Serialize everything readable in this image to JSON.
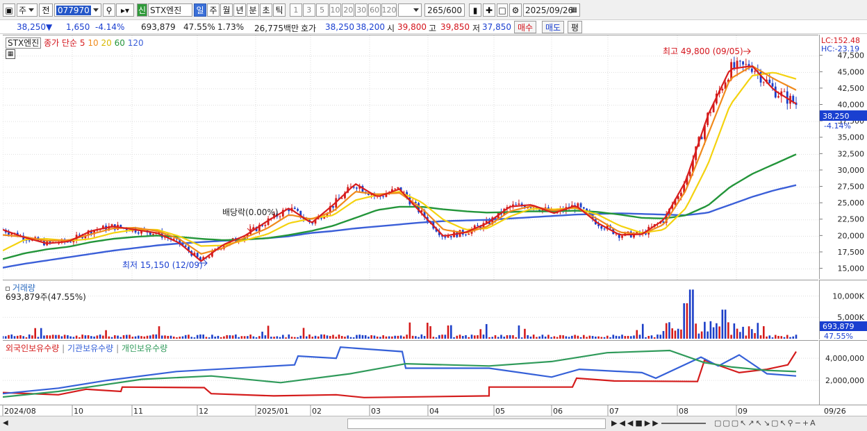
{
  "toolbar": {
    "period_options": [
      "주"
    ],
    "mode": "전",
    "code": "077970",
    "badge": "신",
    "name": "STX엔진",
    "intervals": [
      "일",
      "주",
      "월",
      "년",
      "분",
      "초",
      "틱"
    ],
    "selected_interval": "일",
    "tick_nums": [
      "1",
      "3",
      "5",
      "10",
      "20",
      "30",
      "60",
      "120"
    ],
    "count": "265",
    "count_total": "/600",
    "date": "2025/09/26"
  },
  "info": {
    "price": "38,250",
    "change": "1,650",
    "change_pct": "-4.14%",
    "volume": "693,879",
    "vol_ratio": "47.55%",
    "turnover": "1.73%",
    "amount": "26,775백만",
    "quote_label": "호가",
    "ask": "38,250",
    "bid": "38,200",
    "open_label": "시",
    "open": "39,800",
    "high_label": "고",
    "high": "39,850",
    "low_label": "저",
    "low": "37,850",
    "buy_label": "매수",
    "sell_label": "매도",
    "eval_label": "평"
  },
  "price_panel": {
    "legend_name": "STX엔진",
    "legend_ma": "종가 단순",
    "ma_periods": [
      "5",
      "10",
      "20",
      "60",
      "120"
    ],
    "ma_colors": [
      "#d81e1e",
      "#f08a1c",
      "#f4d20e",
      "#23953a",
      "#3b5fd8"
    ],
    "lc": "LC:152.48",
    "hc": "HC:-23.19",
    "y_ticks": [
      "47,500",
      "45,000",
      "42,500",
      "40,000",
      "37,500",
      "35,000",
      "32,500",
      "30,000",
      "27,500",
      "25,000",
      "22,500",
      "20,000",
      "17,500",
      "15,000"
    ],
    "current_price": "38,250",
    "current_pct": "-4.14%",
    "high_note": "최고 49,800 (09/05)",
    "low_note": "최저 15,150 (12/09)",
    "div_note": "배당락(0.00%)"
  },
  "volume_panel": {
    "title": "거래량",
    "value": "693,879주(47.55%)",
    "y_ticks": [
      "10,000K",
      "5,000K"
    ],
    "current": "693,879",
    "current_pct": "47.55%"
  },
  "holdings_panel": {
    "series": [
      "외국인보유수량",
      "기관보유수량",
      "개인보유수량"
    ],
    "colors": [
      "#d41b1b",
      "#3560d8",
      "#2f9a5a"
    ],
    "y_ticks": [
      "4,000,000",
      "2,000,000"
    ]
  },
  "x_axis": {
    "labels": [
      "2024/08",
      "10",
      "11",
      "12",
      "2025/01",
      "02",
      "03",
      "04",
      "05",
      "06",
      "07",
      "08",
      "09"
    ],
    "right_label": "09/26"
  },
  "chart_data": {
    "type": "line",
    "x_months": [
      "2024/08",
      "10",
      "11",
      "12",
      "2025/01",
      "02",
      "03",
      "04",
      "05",
      "06",
      "07",
      "08",
      "09"
    ],
    "ylim": [
      14000,
      49800
    ],
    "series": [
      {
        "name": "5",
        "values": [
          21000,
          19800,
          18900,
          19200,
          20800,
          21500,
          21000,
          20500,
          19000,
          16200,
          18700,
          20100,
          22300,
          24300,
          22000,
          24800,
          28000,
          26000,
          27200,
          23500,
          20000,
          20600,
          22000,
          24500,
          24800,
          23500,
          24700,
          22000,
          20200,
          20300,
          22500,
          28500,
          38500,
          45500,
          46000,
          42300,
          40200
        ]
      },
      {
        "name": "10",
        "values": [
          20200,
          19900,
          19300,
          19400,
          20300,
          21200,
          21300,
          20800,
          19600,
          17300,
          18200,
          19800,
          21200,
          23300,
          22600,
          23800,
          26800,
          26400,
          26600,
          24300,
          21000,
          20500,
          21500,
          23800,
          24600,
          23900,
          24400,
          22600,
          20600,
          20300,
          21800,
          27000,
          35500,
          44000,
          46000,
          44000,
          42300
        ]
      },
      {
        "name": "20",
        "values": [
          17800,
          19500,
          19600,
          19300,
          19600,
          20500,
          21000,
          21000,
          20000,
          18500,
          18600,
          19400,
          20300,
          22000,
          22700,
          23200,
          25500,
          26300,
          26800,
          25200,
          22500,
          21000,
          21200,
          23000,
          24200,
          24100,
          24300,
          23300,
          21600,
          20500,
          21000,
          24300,
          31000,
          40000,
          44500,
          45000,
          44000
        ]
      },
      {
        "name": "60",
        "values": [
          16500,
          17400,
          18000,
          18400,
          19100,
          19600,
          19900,
          20100,
          19900,
          19600,
          19400,
          19500,
          19700,
          20200,
          20800,
          21600,
          22800,
          24000,
          24500,
          24500,
          24100,
          23800,
          23600,
          23700,
          23800,
          23800,
          23900,
          23700,
          23300,
          22800,
          22700,
          23200,
          24700,
          27500,
          29500,
          31000,
          32500
        ]
      },
      {
        "name": "120",
        "values": [
          15200,
          15800,
          16300,
          16800,
          17300,
          17800,
          18200,
          18600,
          18900,
          19100,
          19300,
          19500,
          19700,
          20000,
          20500,
          20800,
          21200,
          21500,
          21800,
          22100,
          22300,
          22400,
          22500,
          22700,
          22900,
          23100,
          23300,
          23400,
          23500,
          23400,
          23300,
          23200,
          23600,
          24800,
          26000,
          27000,
          27800
        ]
      }
    ]
  }
}
